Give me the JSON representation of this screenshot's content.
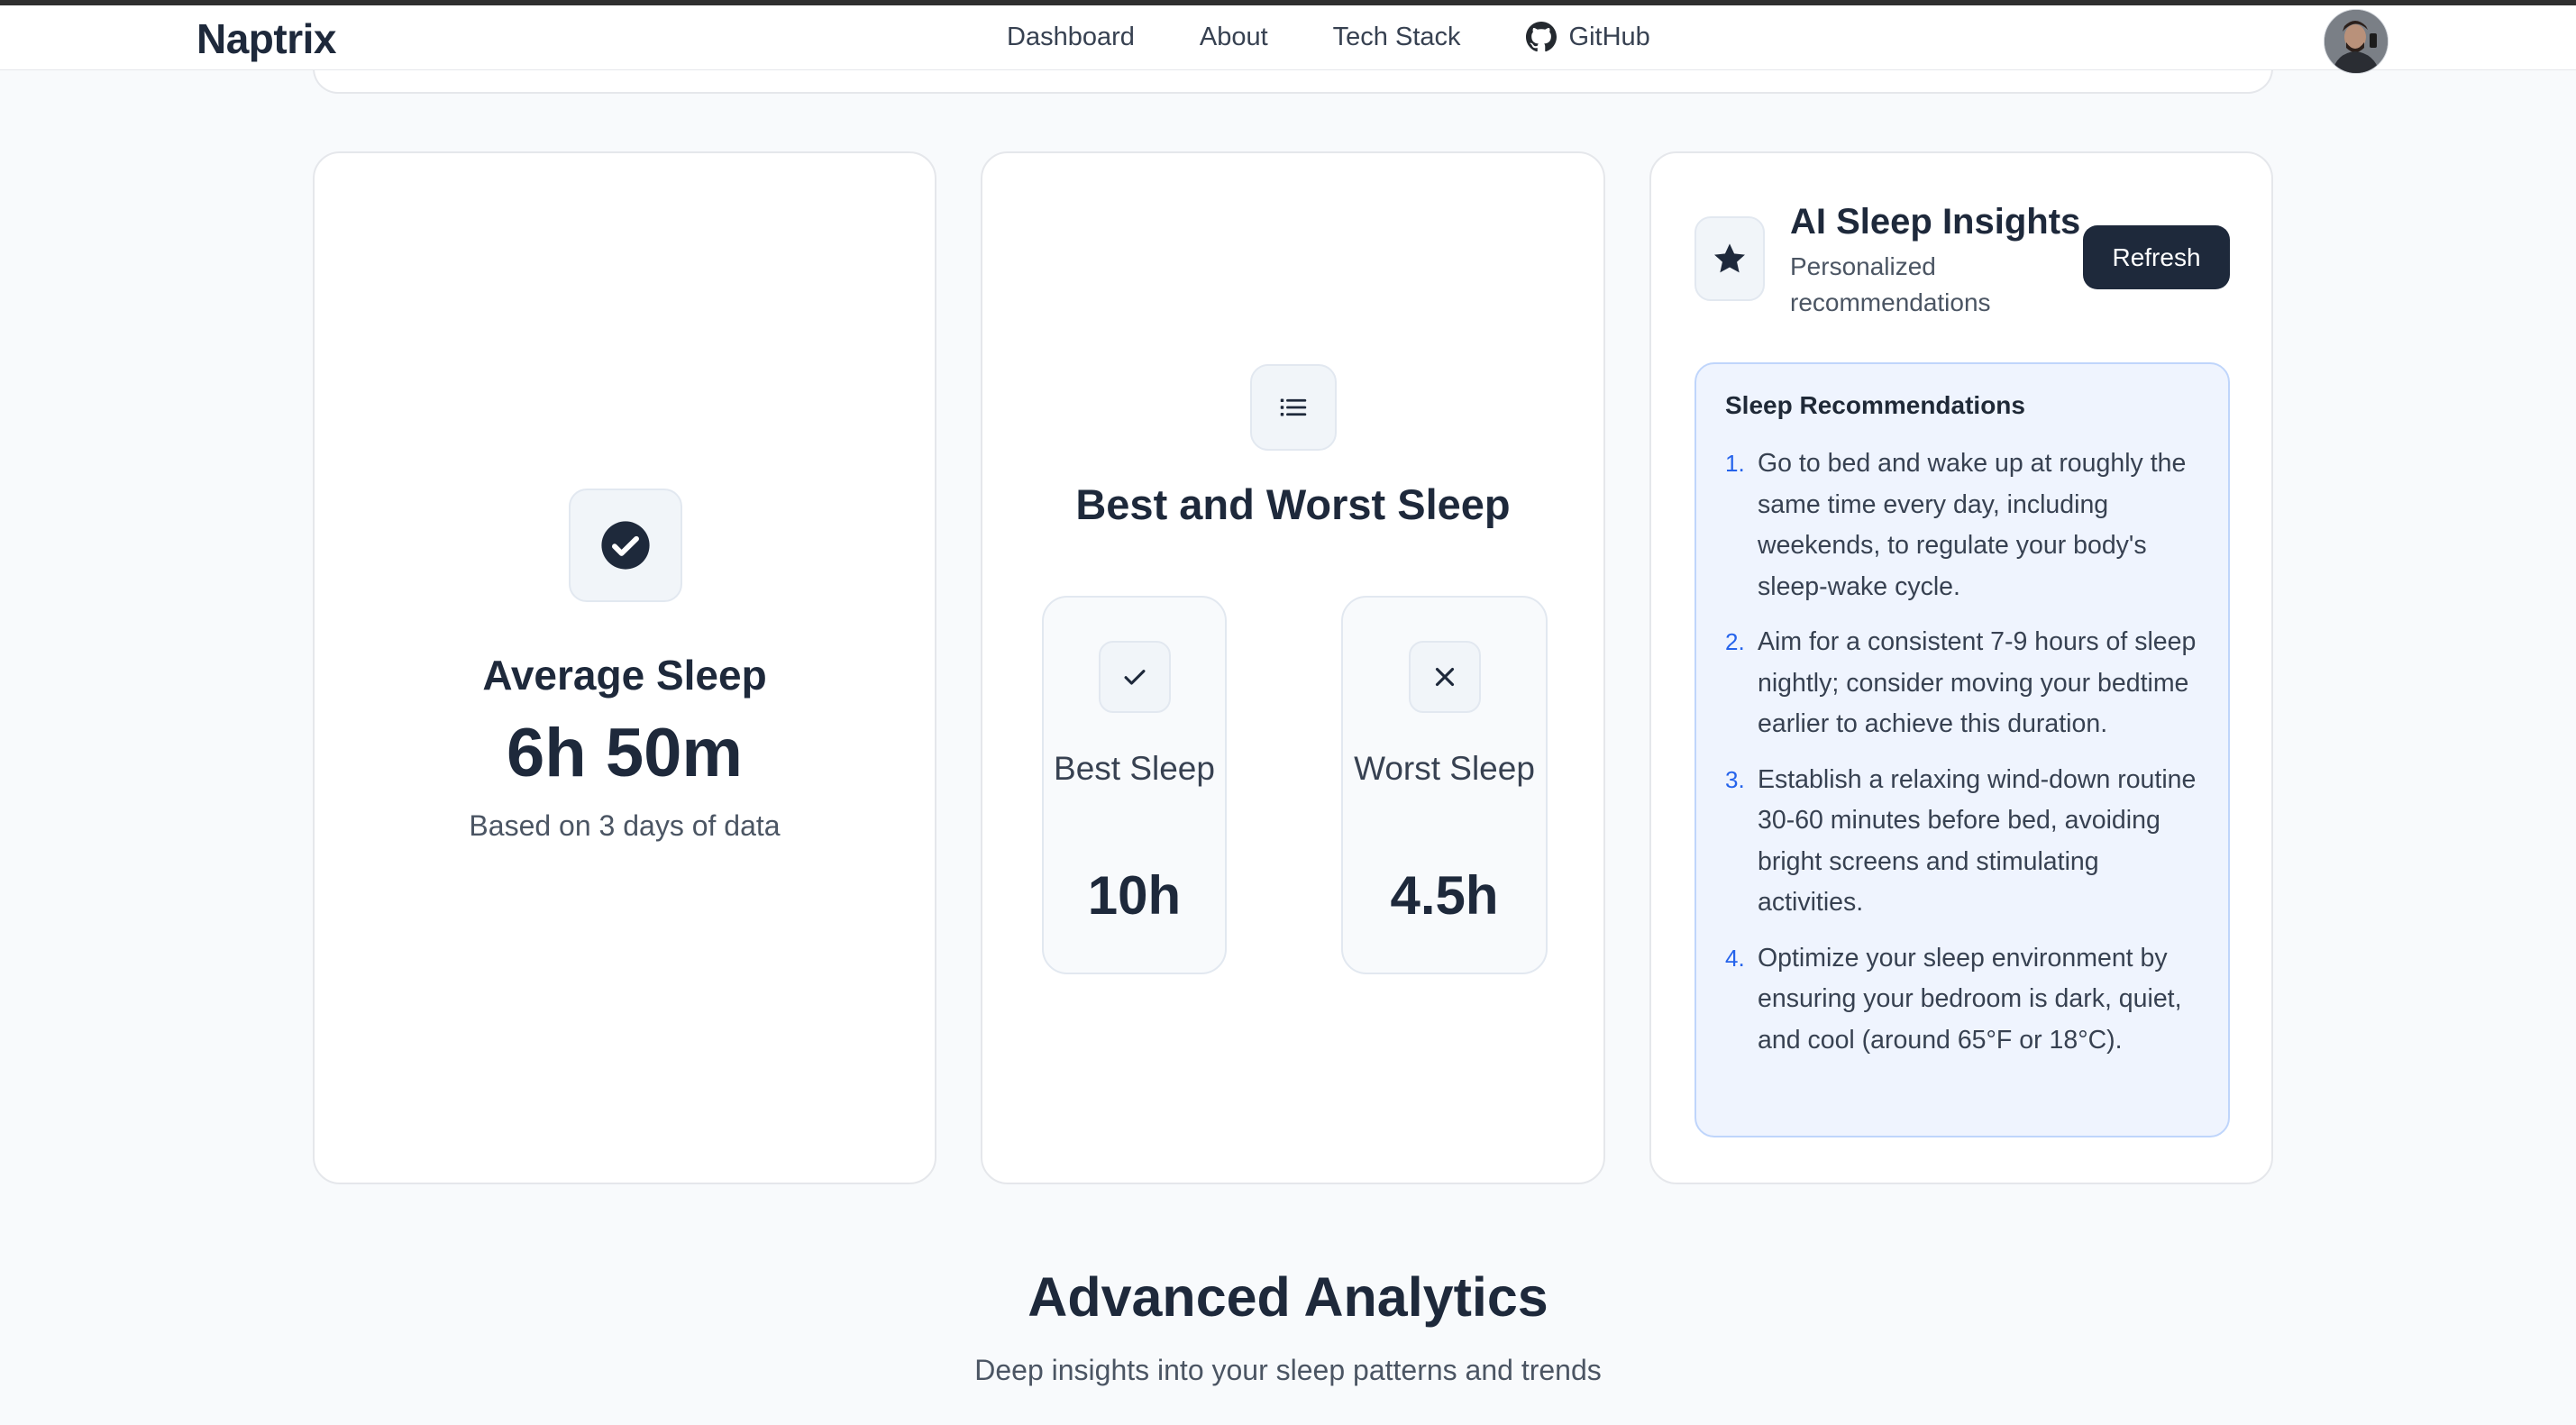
{
  "nav": {
    "brand": "Naptrix",
    "links": [
      "Dashboard",
      "About",
      "Tech Stack",
      "GitHub"
    ]
  },
  "average": {
    "icon": "check-circle-icon",
    "title": "Average Sleep",
    "value": "6h 50m",
    "subtitle": "Based on 3 days of data"
  },
  "best_worst": {
    "icon": "list-icon",
    "title": "Best and Worst Sleep",
    "best": {
      "icon": "check-icon",
      "label": "Best Sleep",
      "value": "10h"
    },
    "worst": {
      "icon": "x-icon",
      "label": "Worst Sleep",
      "value": "4.5h"
    }
  },
  "ai": {
    "icon": "star-icon",
    "title": "AI Sleep Insights",
    "subtitle": "Personalized recommendations",
    "refresh_label": "Refresh",
    "recommendations_title": "Sleep Recommendations",
    "recommendations": [
      {
        "num": "1.",
        "text": "Go to bed and wake up at roughly the same time every day, including weekends, to regulate your body's sleep-wake cycle."
      },
      {
        "num": "2.",
        "text": "Aim for a consistent 7-9 hours of sleep nightly; consider moving your bedtime earlier to achieve this duration."
      },
      {
        "num": "3.",
        "text": "Establish a relaxing wind-down routine 30-60 minutes before bed, avoiding bright screens and stimulating activities."
      },
      {
        "num": "4.",
        "text": "Optimize your sleep environment by ensuring your bedroom is dark, quiet, and cool (around 65°F or 18°C)."
      }
    ]
  },
  "advanced": {
    "title": "Advanced Analytics",
    "subtitle": "Deep insights into your sleep patterns and trends"
  },
  "colors": {
    "primary": "#1e293b",
    "accent_blue": "#2563eb",
    "recommendation_bg": "#eff4fe"
  }
}
